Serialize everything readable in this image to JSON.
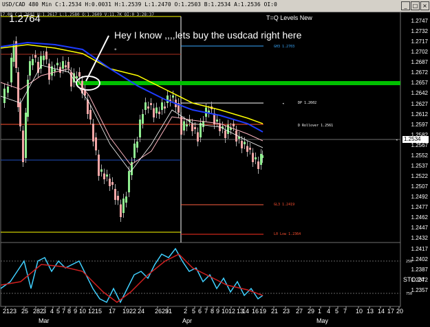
{
  "window": {
    "title": "USD/CAD  480 Min  C:1.2534  H:0.0031  H:1.2539  L:1.2470  O:1.2503  B:1.2534  A:1.2536  OI:0",
    "subline": "17.00  C:1.2601  H:1.2617  L:1.2580  O:1.2609  V:11.7K  OI:0  3:28:37",
    "buttons": [
      "_",
      "□",
      "×"
    ]
  },
  "chart": {
    "big_price": "1.2764",
    "indicator_title": "T=Q Levels New",
    "annotation": "Hey I know ,,,,lets buy the usdcad right here",
    "annotation_dot": "°",
    "current_price": "1.2534",
    "levels": [
      {
        "label": "GH3 1.2703",
        "color": "#39a9ff"
      },
      {
        "label": "DP 1.2602",
        "color": "#ffffff"
      },
      {
        "label": "D Rollover 1.2561",
        "color": "#ffffff"
      },
      {
        "label": "GL3 1.2419",
        "color": "#ff5030"
      },
      {
        "label": "L0 Low 1.2364",
        "color": "#ff5030"
      }
    ],
    "y_axis": [
      "1.2747",
      "1.2732",
      "1.2717",
      "1.2702",
      "1.2687",
      "1.2672",
      "1.2657",
      "1.2642",
      "1.2627",
      "1.2612",
      "1.2597",
      "1.2582",
      "1.2567",
      "1.2552",
      "1.2537",
      "1.2522",
      "1.2507",
      "1.2492",
      "1.2477",
      "1.2462",
      "1.2447",
      "1.2432",
      "1.2417",
      "1.2402",
      "1.2387",
      "1.2372",
      "1.2357"
    ],
    "x_days": [
      "2123",
      "25",
      "282",
      "3",
      "4",
      "5",
      "7",
      "8",
      "9",
      "10",
      "1215",
      "17",
      "1922",
      "24",
      "2629",
      "31",
      "2",
      "5",
      "6",
      "7",
      "8",
      "9",
      "10",
      "12",
      "13",
      "14",
      "16",
      "19",
      "21",
      "23",
      "27",
      "29",
      "1",
      "4",
      "5",
      "7",
      "10",
      "13",
      "14",
      "17",
      "20"
    ],
    "x_months": [
      "Mar",
      "Apr",
      "May"
    ],
    "oscillator": {
      "name": "STO 24",
      "ticks": [
        "250",
        "750"
      ]
    },
    "colors": {
      "background": "#000000",
      "bull_candle": "#90ee90",
      "bear_candle": "#f4a6a6",
      "ma_yellow": "#ffff00",
      "ma_blue": "#1e3cff",
      "ma_pink": "#ffb6c1",
      "entry_line": "#00c000",
      "osc_fast": "#40d0ff",
      "osc_slow": "#d02020"
    }
  }
}
